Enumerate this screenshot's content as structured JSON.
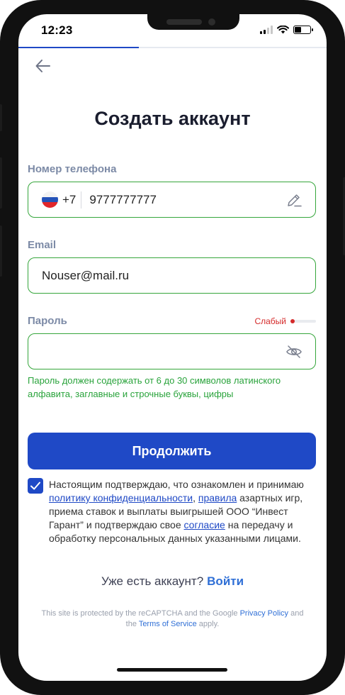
{
  "status_bar": {
    "time": "12:23"
  },
  "signup": {
    "progress": 0.39,
    "title": "Создать аккаунт",
    "phone": {
      "label": "Номер телефона",
      "country_code": "+7",
      "value": "9777777777"
    },
    "email": {
      "label": "Email",
      "value": "Nouser@mail.ru"
    },
    "password": {
      "label": "Пароль",
      "value": "",
      "strength_text": "Слабый",
      "strength_level": 0.15,
      "hint": "Пароль должен содержать от 6 до 30 символов латинского алфавита, заглавные и строчные буквы, цифры"
    },
    "submit_label": "Продолжить",
    "consent": {
      "checked": true,
      "part1": "Настоящим подтверждаю, что ознакомлен и принимаю ",
      "link1": "политику конфиденциальности",
      "part2": ", ",
      "link2": "правила",
      "part3": " азартных игр, приема ставок и выплаты выигрышей ООО “Инвест Гарант” и подтверждаю свое ",
      "link3": "согласие",
      "part4": " на передачу и обработку персональных данных указанными лицами."
    },
    "login": {
      "question": "Уже есть аккаунт?",
      "link": "Войти"
    },
    "recaptcha": {
      "part1": "This site is protected by the reCAPTCHA and the Google ",
      "privacy_link": "Privacy Policy",
      "part2": " and the ",
      "terms_link": "Terms of Service",
      "part3": " apply."
    }
  },
  "icons": {
    "back": "arrow-left-icon",
    "flag": "russia-flag-icon",
    "edit": "pencil-icon",
    "visibility": "eye-off-icon",
    "checkbox": "checkmark-icon"
  },
  "colors": {
    "accent": "#1f49c6",
    "valid": "#36a63c",
    "hint": "#29a33b",
    "weak": "#d42a2a",
    "link": "#2f6fd6"
  }
}
